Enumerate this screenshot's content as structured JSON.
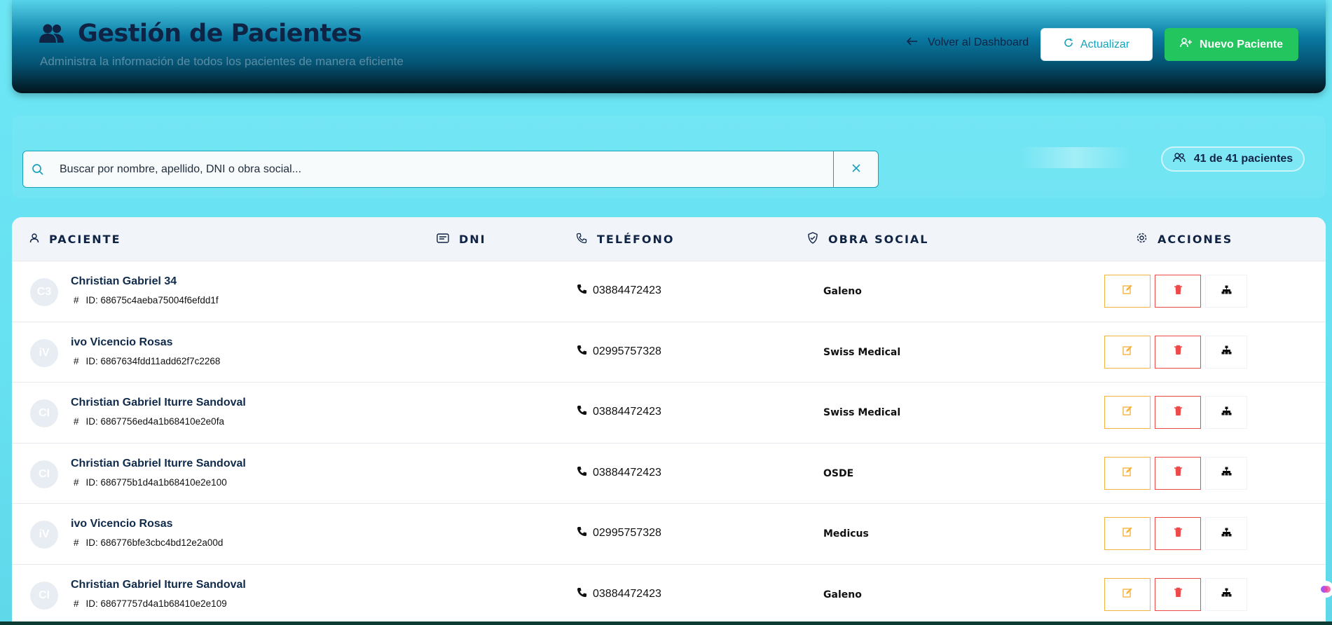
{
  "header": {
    "title": "Gestión de Pacientes",
    "subtitle": "Administra la información de todos los pacientes de manera eficiente",
    "back_label": "Volver al Dashboard",
    "refresh_label": "Actualizar",
    "new_label": "Nuevo Paciente"
  },
  "search": {
    "placeholder": "Buscar por nombre, apellido, DNI o obra social...",
    "count": "41 de 41 pacientes"
  },
  "table": {
    "headers": {
      "patient": "PACIENTE",
      "dni": "DNI",
      "phone": "TELÉFONO",
      "obra": "OBRA SOCIAL",
      "actions": "ACCIONES"
    },
    "rows": [
      {
        "initials": "C3",
        "name": "Christian Gabriel 34",
        "id": "ID: 68675c4aeba75004f6efdd1f",
        "phone": "03884472423",
        "obra": "Galeno"
      },
      {
        "initials": "iV",
        "name": "ivo Vicencio Rosas",
        "id": "ID: 6867634fdd11add62f7c2268",
        "phone": "02995757328",
        "obra": "Swiss Medical"
      },
      {
        "initials": "CI",
        "name": "Christian Gabriel Iturre Sandoval",
        "id": "ID: 6867756ed4a1b68410e2e0fa",
        "phone": "03884472423",
        "obra": "Swiss Medical"
      },
      {
        "initials": "CI",
        "name": "Christian Gabriel Iturre Sandoval",
        "id": "ID: 686775b1d4a1b68410e2e100",
        "phone": "03884472423",
        "obra": "OSDE"
      },
      {
        "initials": "iV",
        "name": "ivo Vicencio Rosas",
        "id": "ID: 686776bfe3cbc4bd12e2a00d",
        "phone": "02995757328",
        "obra": "Medicus"
      },
      {
        "initials": "CI",
        "name": "Christian Gabriel Iturre Sandoval",
        "id": "ID: 68677757d4a1b68410e2e109",
        "phone": "03884472423",
        "obra": "Galeno"
      }
    ]
  },
  "colors": {
    "accent": "#17a2b8",
    "success": "#22c55e",
    "edit": "#f5b342",
    "delete": "#ef4a4a"
  },
  "icons": {
    "users": "users-icon",
    "back": "arrow-left-icon",
    "refresh": "refresh-icon",
    "new": "user-plus-icon",
    "search": "search-icon",
    "clear": "close-icon",
    "edit": "edit-icon",
    "delete": "trash-icon",
    "tree": "sitemap-icon"
  }
}
